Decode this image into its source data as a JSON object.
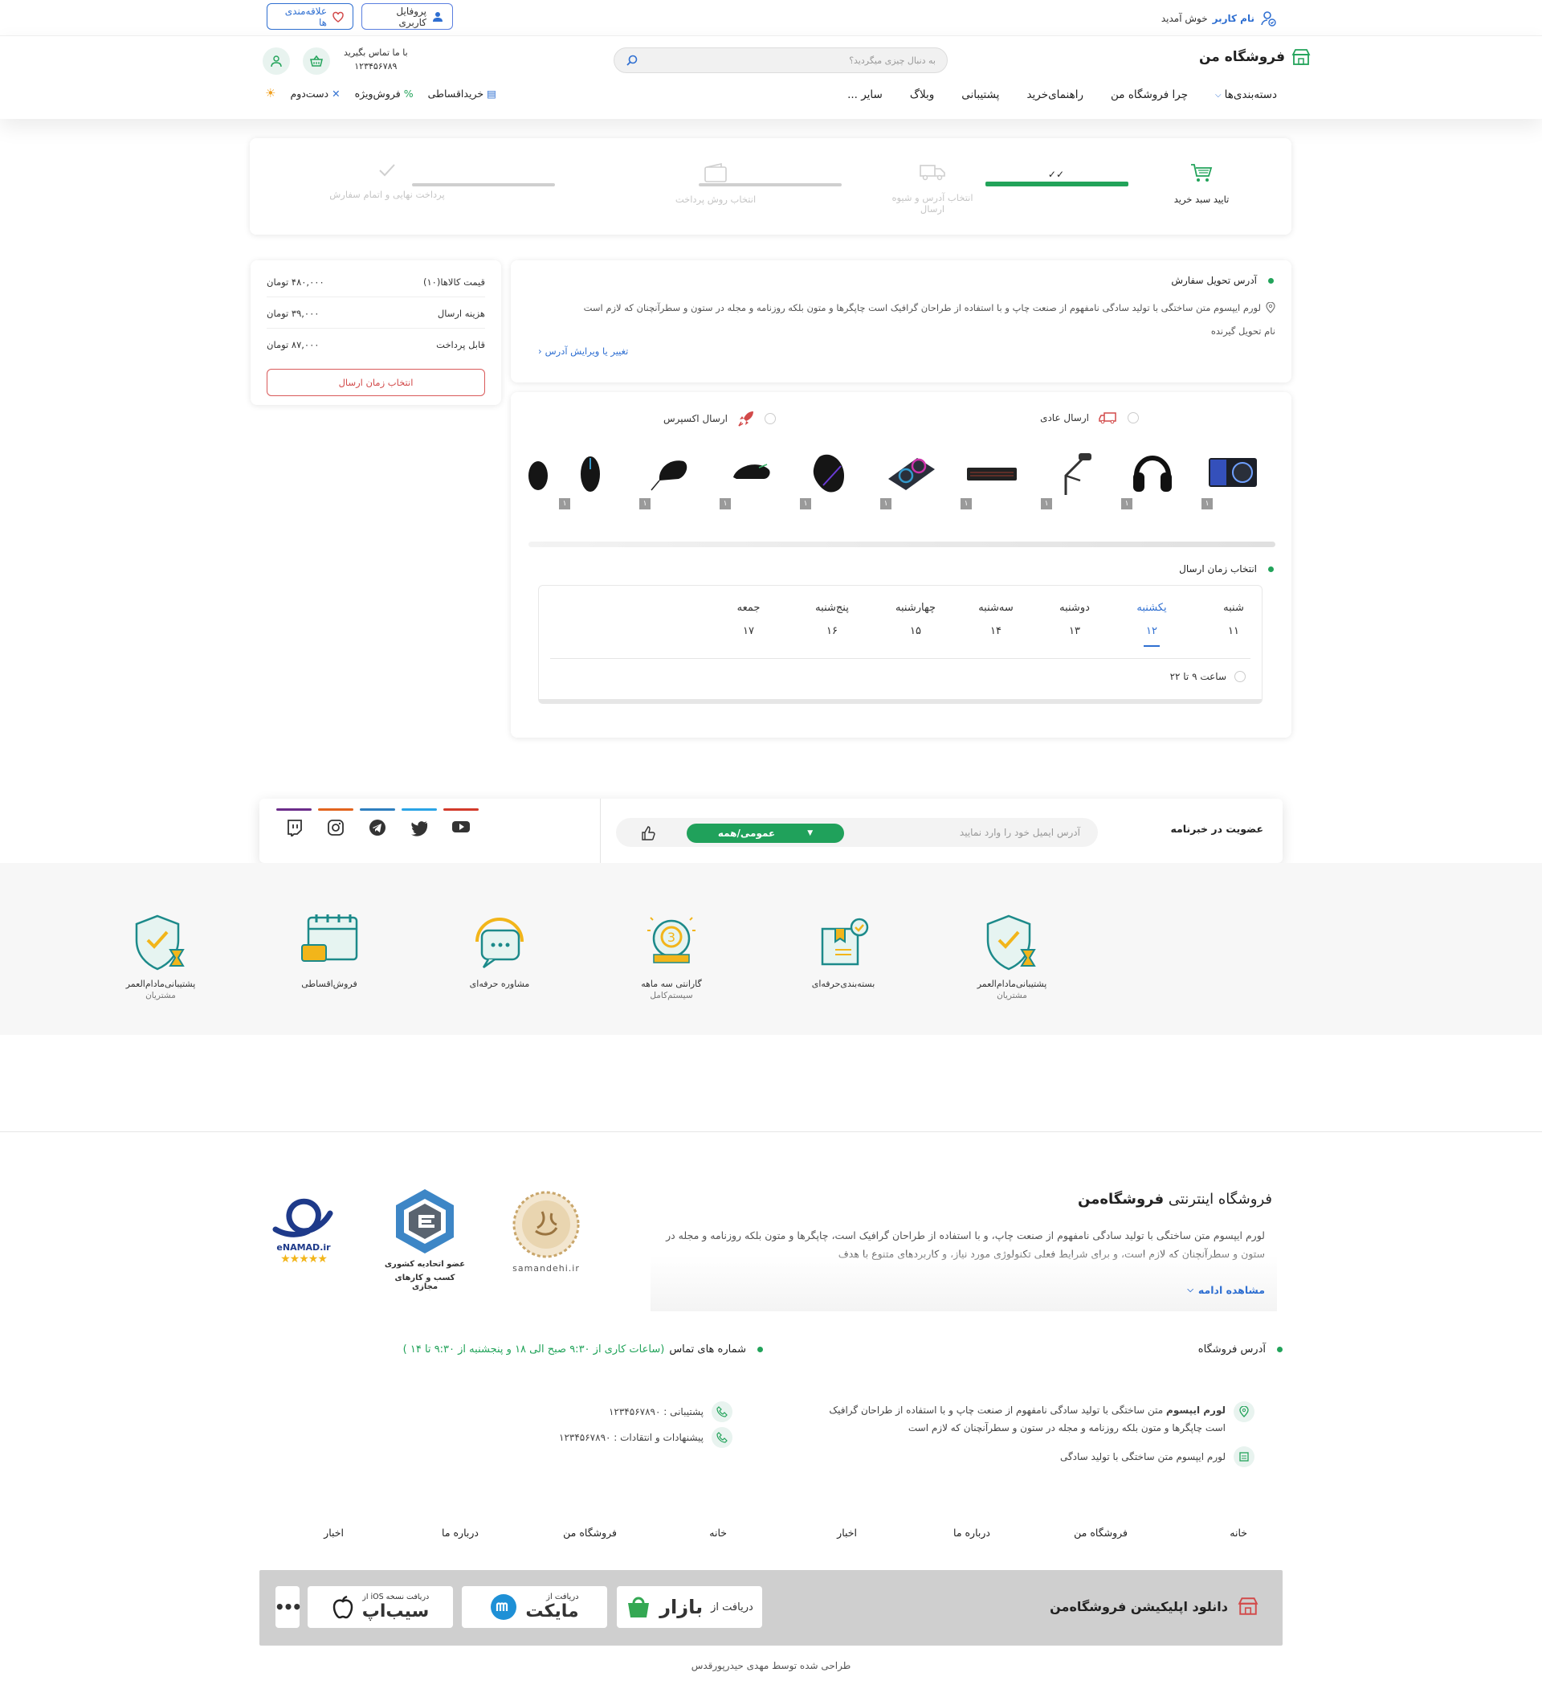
{
  "topbar": {
    "welcome": "خوش آمدید",
    "username": "نام کاربر",
    "profile_label": "پروفایل کاربری",
    "favorites_label": "علاقه‌مندی ها"
  },
  "header": {
    "logo": "فروشگاه من",
    "search_placeholder": "به دنبال چیزی میگردید؟",
    "contact_label": "با ما تماس بگیرید",
    "contact_number": "۱۲۳۴۵۶۷۸۹",
    "nav": [
      "دسته‌بندی‌ها",
      "چرا فروشگاه من",
      "راهنمای‌خرید",
      "پشتیبانی",
      "وبلاگ",
      "سایر ..."
    ],
    "nav_left": [
      "خریداقساطی",
      "فروش‌ویژه",
      "دست‌دوم"
    ]
  },
  "stepper": {
    "steps": [
      "تایید سبد خرید",
      "انتخاب آدرس و شیوه ارسال",
      "انتخاب روش پرداخت",
      "پرداخت نهایی و اتمام سفارش"
    ]
  },
  "summary": {
    "rows": [
      {
        "label": "قیمت کالاها(۱۰)",
        "value": "۴۸۰,۰۰۰ تومان"
      },
      {
        "label": "هزینه ارسال",
        "value": "۳۹,۰۰۰ تومان"
      },
      {
        "label": "قابل پرداخت",
        "value": "۸۷,۰۰۰ تومان"
      }
    ],
    "button": "انتخاب زمان ارسال"
  },
  "address": {
    "title": "آدرس تحویل سفارش",
    "text": "لورم ایپسوم متن ساختگی با تولید سادگی نامفهوم از صنعت چاپ و با استفاده از طراحان گرافیک است چاپگرها و متون بلکه روزنامه و مجله در ستون و سطرآنچنان که لازم است",
    "receiver": "نام تحویل گیرنده",
    "edit_link": "تغییر یا ویرایش آدرس"
  },
  "shipping": {
    "normal": "ارسال عادی",
    "express": "ارسال اکسپرس",
    "products": [
      {
        "name": "gpu",
        "qty": "۱"
      },
      {
        "name": "headset",
        "qty": "۱"
      },
      {
        "name": "mic-arm",
        "qty": "۱"
      },
      {
        "name": "keyboard",
        "qty": "۱"
      },
      {
        "name": "cooling-pad",
        "qty": "۱"
      },
      {
        "name": "mouse-1",
        "qty": "۱"
      },
      {
        "name": "mouse-2",
        "qty": "۱"
      },
      {
        "name": "mouse-3",
        "qty": "۱"
      },
      {
        "name": "mouse-4",
        "qty": "۱"
      },
      {
        "name": "mouse-5",
        "qty": ""
      }
    ],
    "time_title": "انتخاب زمان ارسال",
    "days": [
      {
        "day": "شنبه",
        "num": "۱۱"
      },
      {
        "day": "یکشنبه",
        "num": "۱۲"
      },
      {
        "day": "دوشنبه",
        "num": "۱۳"
      },
      {
        "day": "سه‌شنبه",
        "num": "۱۴"
      },
      {
        "day": "چهارشنبه",
        "num": "۱۵"
      },
      {
        "day": "پنج‌شنبه",
        "num": "۱۶"
      },
      {
        "day": "جمعه",
        "num": "۱۷"
      }
    ],
    "slot": "ساعت ۹ تا ۲۲"
  },
  "newsletter": {
    "title": "عضویت در خبرنامه",
    "placeholder": "آدرس ایمیل خود را وارد نمایید",
    "select": "عمومی/همه"
  },
  "features": [
    {
      "title": "پشتیبانی‌مادام‌العمر",
      "sub": "مشتریان"
    },
    {
      "title": "بسته‌بندی‌حرفه‌ای",
      "sub": ""
    },
    {
      "title": "گارانتی سه ماهه",
      "sub": "سیستم‌کامل"
    },
    {
      "title": "مشاوره حرفه‌ای",
      "sub": ""
    },
    {
      "title": "فروش‌اقساطی",
      "sub": ""
    },
    {
      "title": "پشتیبانی‌مادام‌العمر",
      "sub": "مشتریان"
    }
  ],
  "footer": {
    "title_prefix": "فروشگاه اینترنتی",
    "title_brand": "فروشگاه‌من",
    "text": "لورم ایپسوم متن ساختگی با تولید سادگی نامفهوم از صنعت چاپ، و با استفاده از طراحان گرافیک است، چاپگرها و متون بلکه روزنامه و مجله در ستون و سطرآنچنان که لازم است، و برای شرایط فعلی تکنولوژی مورد نیاز، و کاربردهای متنوع با هدف",
    "more": "مشاهده ادامه",
    "badges": [
      "samandehi.ir",
      "عضو اتحادیه کشوری",
      "کسب و کارهای مجازی",
      "eNAMAD.ir"
    ],
    "address_title": "آدرس فروشگاه",
    "address_bold": "لورم ایپسوم",
    "address_text": "متن ساختگی با تولید سادگی نامفهوم از صنعت چاپ و با استفاده از طراحان گرافیک",
    "address_text2": "است چاپگرها و متون بلکه روزنامه و مجله در ستون و سطرآنچنان که لازم است",
    "address_line2": "لورم ایپسوم متن ساختگی با تولید سادگی",
    "contact_title": "شماره های تماس",
    "contact_hours": "(ساعات کاری از ۹:۳۰ صبح الی ۱۸ و پنجشنبه از ۹:۳۰ تا ۱۴ )",
    "support": "پشتیبانی : ۱۲۳۴۵۶۷۸۹۰",
    "feedback": "پیشنهادات و انتقادات : ۱۲۳۴۵۶۷۸۹۰",
    "links": [
      "خانه",
      "فروشگاه من",
      "درباره ما",
      "اخبار",
      "خانه",
      "فروشگاه من",
      "درباره ما",
      "اخبار"
    ],
    "app_title": "دانلود اپلیکیشن فروشگاه‌من",
    "bazaar_pre": "دریافت از",
    "bazaar": "بازار",
    "myket_pre": "دریافت از",
    "myket": "مایکت",
    "sibapp_pre": "دریافت نسخه iOS از",
    "sibapp": "سیب‌اپ",
    "credit": "طراحی شده توسط مهدی حیدرپورقدس"
  },
  "colors": {
    "brand_green": "#22a35a",
    "link_blue": "#2f6fd1",
    "accent_red": "#d24a4a"
  }
}
